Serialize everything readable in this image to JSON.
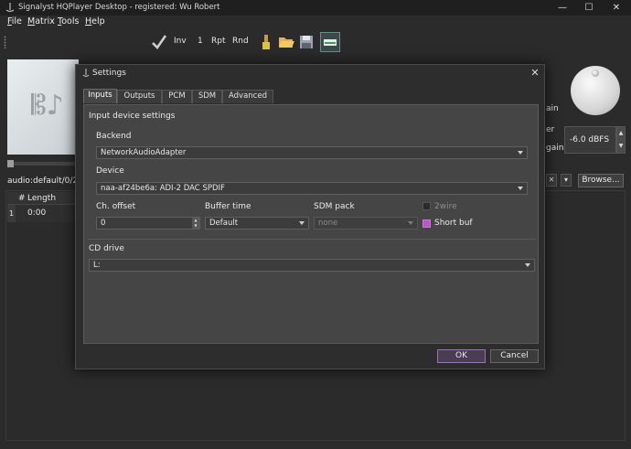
{
  "window": {
    "title": "Signalyst HQPlayer Desktop - registered: Wu Robert",
    "minimize_glyph": "—",
    "maximize_glyph": "☐",
    "close_glyph": "✕"
  },
  "menubar": {
    "items": [
      {
        "label": "File",
        "accel": "F",
        "rest": "ile"
      },
      {
        "label": "Matrix",
        "accel": "M",
        "rest": "atrix"
      },
      {
        "label": "Tools",
        "accel": "T",
        "rest": "ools"
      },
      {
        "label": "Help",
        "accel": "H",
        "rest": "elp"
      }
    ]
  },
  "toolbar": {
    "inv": "Inv",
    "one": "1",
    "rpt": "Rpt",
    "rnd": "Rnd",
    "icons": [
      "checkmark-icon",
      "brush-icon",
      "folder-open-icon",
      "save-icon",
      "hard-drive-icon"
    ]
  },
  "main": {
    "side_labels": [
      "ain",
      "er",
      "gain"
    ],
    "volume": "-6.0 dBFS",
    "output_device": "audio:default/0/2",
    "browse_label": "Browse...",
    "clear_glyph": "✕",
    "table": {
      "headers": [
        "#",
        "Length"
      ],
      "rows": [
        {
          "num": "1",
          "length": "0:00"
        }
      ]
    }
  },
  "dialog": {
    "title": "Settings",
    "close_glyph": "✕",
    "tabs": [
      "Inputs",
      "Outputs",
      "PCM",
      "SDM",
      "Advanced"
    ],
    "active_tab": "Inputs",
    "input_device_settings": "Input device settings",
    "backend": {
      "label": "Backend",
      "value": "NetworkAudioAdapter"
    },
    "device": {
      "label": "Device",
      "value": "naa-af24be6a: ADI-2 DAC SPDIF"
    },
    "ch_offset": {
      "label": "Ch. offset",
      "value": "0"
    },
    "buffer_time": {
      "label": "Buffer time",
      "value": "Default"
    },
    "sdm_pack": {
      "label": "SDM pack",
      "value": "none"
    },
    "two_wire": {
      "label": "2wire",
      "checked": false
    },
    "short_buf": {
      "label": "Short buf",
      "checked": true
    },
    "cd_drive": {
      "label": "CD drive",
      "value": "L:"
    },
    "ok_label": "OK",
    "cancel_label": "Cancel",
    "accent_color": "#b45ac2"
  }
}
